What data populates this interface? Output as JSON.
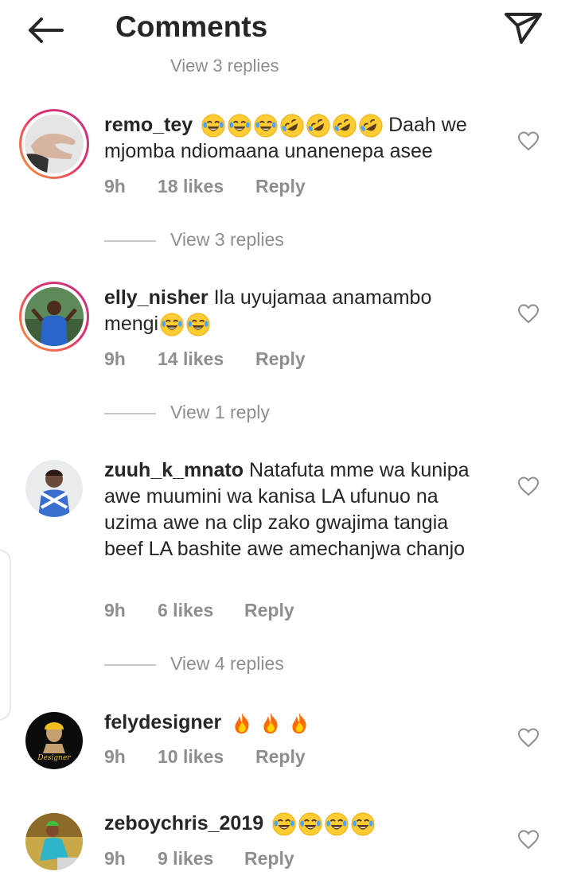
{
  "header": {
    "title": "Comments",
    "back_icon": "arrow-left-icon",
    "send_icon": "paper-plane-icon"
  },
  "top_cut_replies": "View 3 replies",
  "comments": [
    {
      "username": "remo_tey",
      "text_before_emoji": "",
      "emoji_count_laugh": 3,
      "emoji_count_rofl": 4,
      "text": " Daah we mjomba ndiomaana unanenepa asee",
      "time": "9h",
      "likes": "18 likes",
      "reply": "Reply",
      "replies": "View 3 replies"
    },
    {
      "username": "elly_nisher",
      "text": " Ila uyujamaa anamambo mengi",
      "time": "9h",
      "likes": "14 likes",
      "reply": "Reply",
      "replies": "View 1 reply"
    },
    {
      "username": "zuuh_k_mnato",
      "text": " Natafuta mme wa kunipa awe muumini wa kanisa LA ufunuo na uzima awe na clip zako gwajima tangia beef LA bashite awe amechanjwa chanjo",
      "time": "9h",
      "likes": "6 likes",
      "reply": "Reply",
      "replies": "View 4 replies"
    },
    {
      "username": "felydesigner",
      "text": "",
      "time": "9h",
      "likes": "10 likes",
      "reply": "Reply"
    },
    {
      "username": "zeboychris_2019",
      "text": "",
      "time": "9h",
      "likes": "9 likes",
      "reply": "Reply"
    }
  ],
  "colors": {
    "primary_text": "#262626",
    "secondary_text": "#8e8e8e",
    "divider": "#c7c7c7"
  }
}
